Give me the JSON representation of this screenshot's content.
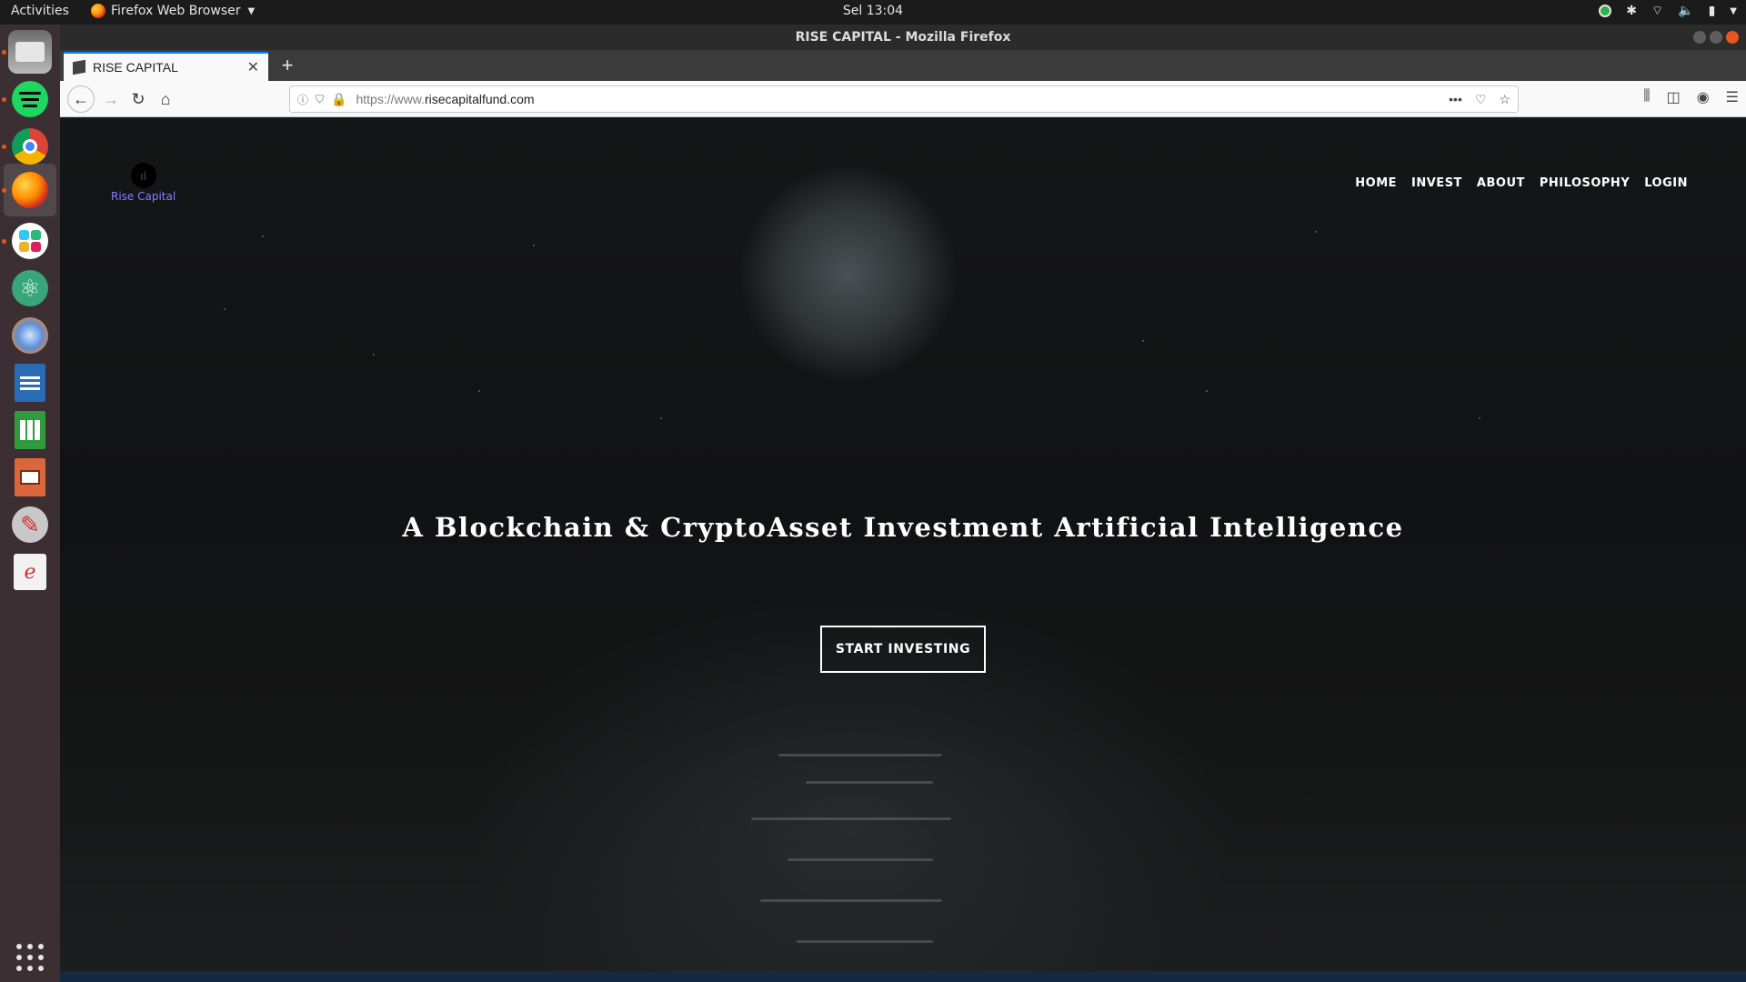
{
  "topbar": {
    "activities": "Activities",
    "app_menu": "Firefox Web Browser",
    "clock": "Sel 13:04"
  },
  "window": {
    "title": "RISE CAPITAL - Mozilla Firefox"
  },
  "tab": {
    "title": "RISE CAPITAL",
    "close": "✕",
    "new_tab": "+"
  },
  "urlbar": {
    "protocol": "https://www.",
    "domain": "risecapitalfund.com"
  },
  "site": {
    "logo_text": "Rise Capital",
    "nav": [
      "HOME",
      "INVEST",
      "ABOUT",
      "PHILOSOPHY",
      "LOGIN"
    ],
    "headline": "A Blockchain & CryptoAsset Investment Artificial Intelligence",
    "cta": "START INVESTING"
  },
  "dock": {
    "apps": [
      "files",
      "spotify",
      "chrome",
      "firefox",
      "slack",
      "atom",
      "system-settings",
      "writer",
      "calc",
      "impress",
      "tools",
      "document-viewer"
    ]
  },
  "colors": {
    "accent": "#e95420",
    "tab_highlight": "#0a84ff",
    "logo_text": "#8a7bff"
  }
}
